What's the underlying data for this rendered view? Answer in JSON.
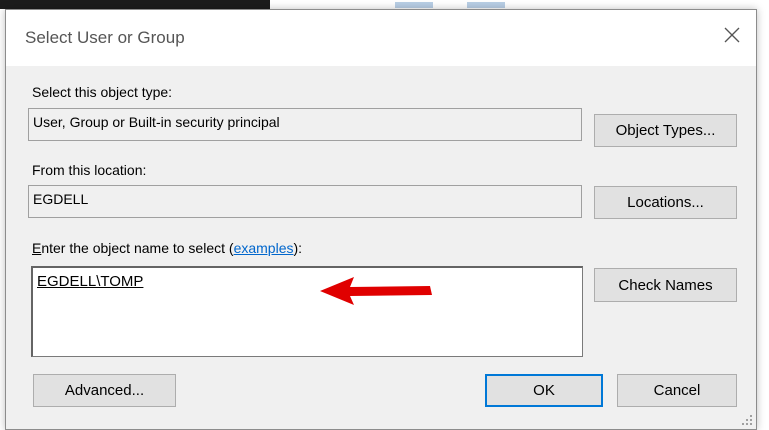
{
  "dialog": {
    "title": "Select User or Group",
    "close_glyph": "✕"
  },
  "object_type": {
    "label": "Select this object type:",
    "value": "User, Group or Built-in security principal",
    "button": "Object Types..."
  },
  "location": {
    "label": "From this location:",
    "value": "EGDELL",
    "button": "Locations..."
  },
  "object_name": {
    "label_first_letter": "E",
    "label_rest": "nter the object name to select (",
    "link_text": "examples",
    "label_end": "):",
    "value": "EGDELL\\TOMP",
    "check_button": "Check Names"
  },
  "footer": {
    "advanced_button": "Advanced...",
    "ok_button": "OK",
    "cancel_button": "Cancel"
  },
  "annotation": {
    "arrow_color": "#e00000"
  },
  "colors": {
    "dialog_bg": "#f0f0f0",
    "accent": "#0078d7",
    "link": "#0066cc"
  }
}
